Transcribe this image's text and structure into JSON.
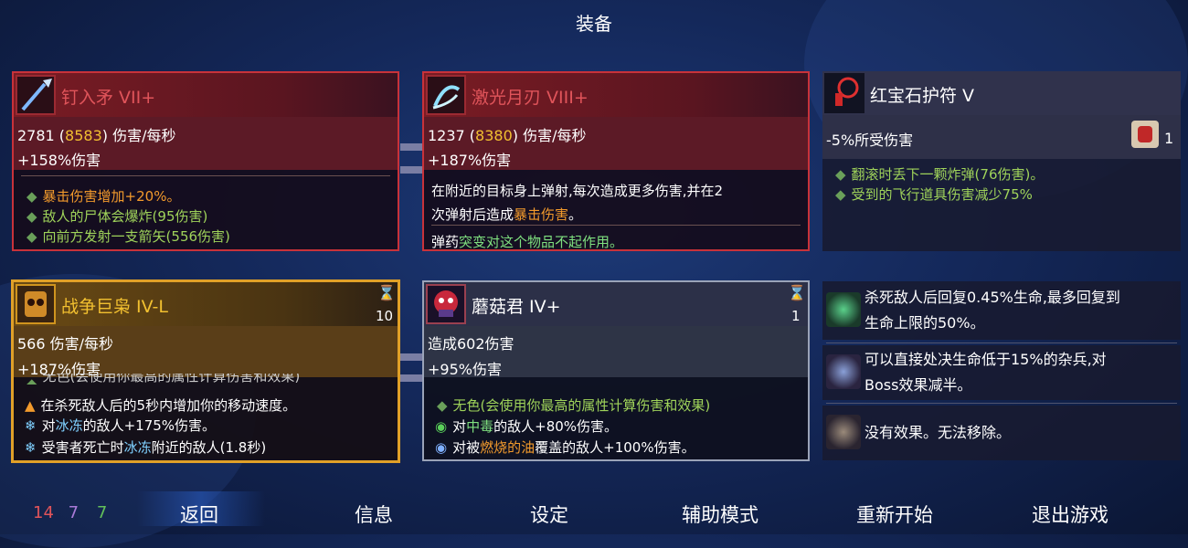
{
  "title": "装备",
  "cards": {
    "weapon1": {
      "name": "钉入矛 VII+",
      "dps_base": "2781",
      "dps_max": "8583",
      "dps_unit": "伤害/每秒",
      "bonus": "+158%伤害",
      "effects": [
        "暴击伤害增加+20%。",
        "敌人的尸体会爆炸(95伤害)",
        "向前方发射一支箭矢(556伤害)"
      ]
    },
    "weapon2": {
      "name": "激光月刃 VIII+",
      "dps_base": "1237",
      "dps_max": "8380",
      "dps_unit": "伤害/每秒",
      "bonus": "+187%伤害",
      "desc_line1": "在附近的目标身上弹射,每次造成更多伤害,并在2",
      "desc_line2_a": "次弹射后造成",
      "desc_line2_b": "暴击伤害",
      "desc_line2_c": "。",
      "note_a": "弹药",
      "note_b": "突变对这个物品不起作用。"
    },
    "amulet": {
      "name": "红宝石护符 V",
      "stat": "-5%所受伤害",
      "count": "1",
      "effects": [
        "翻滚时丢下一颗炸弹(76伤害)。",
        "受到的飞行道具伤害减少75%"
      ]
    },
    "skill1": {
      "name": "战争巨枭 IV-L",
      "timer": "10",
      "dps": "566 伤害/每秒",
      "bonus": "+187%伤害",
      "cut_text": "无色(会使用你最高的属性计算伤害和效果)",
      "eff1": "在杀死敌人后的5秒内增加你的移动速度。",
      "eff2_a": "对",
      "eff2_b": "冰冻",
      "eff2_c": "的敌人+175%伤害。",
      "eff3_a": "受害者死亡时",
      "eff3_b": "冰冻",
      "eff3_c": "附近的敌人(1.8秒)"
    },
    "skill2": {
      "name": "蘑菇君 IV+",
      "timer": "1",
      "dmg": "造成602伤害",
      "bonus": "+95%伤害",
      "eff1": "无色(会使用你最高的属性计算伤害和效果)",
      "eff2_a": "对",
      "eff2_b": "中毒",
      "eff2_c": "的敌人+80%伤害。",
      "eff3_a": "对被",
      "eff3_b": "燃烧的油",
      "eff3_c": "覆盖的敌人+100%伤害。"
    }
  },
  "mutations": [
    {
      "line1": "杀死敌人后回复0.45%生命,最多回复到",
      "line2": "生命上限的50%。",
      "icon": "skull-heal-icon"
    },
    {
      "line1": "可以直接处决生命低于15%的杂兵,对",
      "line2": "Boss效果减半。",
      "icon": "execution-icon"
    },
    {
      "line1": "没有效果。无法移除。",
      "line2": "",
      "icon": "cursed-icon"
    }
  ],
  "scrolls": {
    "red": "14",
    "purple": "7",
    "green": "7"
  },
  "nav": {
    "back": "返回",
    "info": "信息",
    "settings": "设定",
    "assist": "辅助模式",
    "restart": "重新开始",
    "quit": "退出游戏"
  },
  "colors": {
    "brutality": "#e0545a",
    "tactics": "#a87ad8",
    "survival": "#62c05a",
    "accent_gold": "#f2c030"
  }
}
